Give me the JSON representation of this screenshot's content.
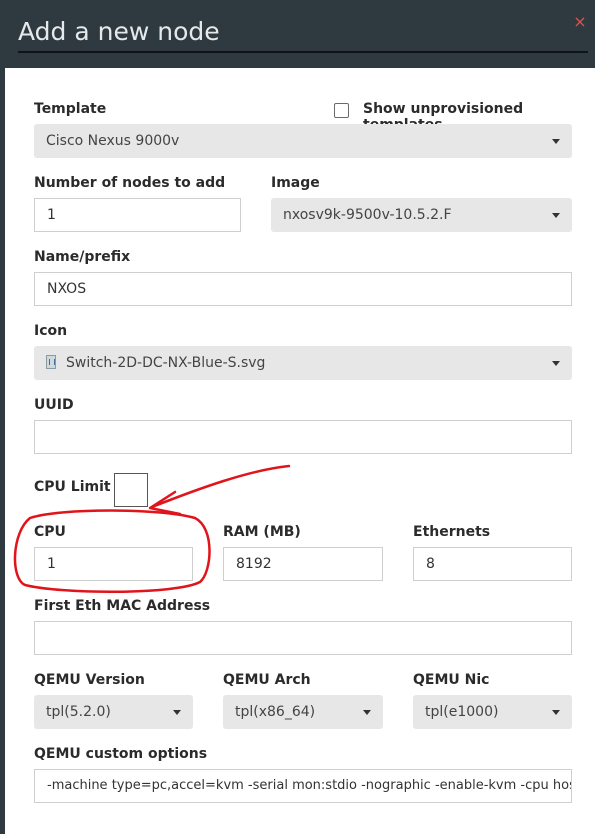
{
  "dialog": {
    "title": "Add a new node",
    "close_glyph": "×"
  },
  "template": {
    "label": "Template",
    "value": "Cisco Nexus 9000v",
    "show_unprovisioned_label": "Show unprovisioned templates",
    "show_unprovisioned_checked": false
  },
  "nodes_count": {
    "label": "Number of nodes to add",
    "value": "1"
  },
  "image": {
    "label": "Image",
    "value": "nxosv9k-9500v-10.5.2.F"
  },
  "name_prefix": {
    "label": "Name/prefix",
    "value": "NXOS"
  },
  "icon": {
    "label": "Icon",
    "value": "Switch-2D-DC-NX-Blue-S.svg",
    "icon_name": "switch-icon"
  },
  "uuid": {
    "label": "UUID",
    "value": ""
  },
  "cpu_limit": {
    "label": "CPU Limit",
    "checked": false
  },
  "cpu": {
    "label": "CPU",
    "value": "1"
  },
  "ram": {
    "label": "RAM (MB)",
    "value": "8192"
  },
  "ethernets": {
    "label": "Ethernets",
    "value": "8"
  },
  "mac": {
    "label": "First Eth MAC Address",
    "value": ""
  },
  "qemu_version": {
    "label": "QEMU Version",
    "value": "tpl(5.2.0)"
  },
  "qemu_arch": {
    "label": "QEMU Arch",
    "value": "tpl(x86_64)"
  },
  "qemu_nic": {
    "label": "QEMU Nic",
    "value": "tpl(e1000)"
  },
  "qemu_custom": {
    "label": "QEMU custom options",
    "value": "-machine type=pc,accel=kvm -serial mon:stdio -nographic -enable-kvm -cpu host"
  },
  "colors": {
    "header_bg": "#2f3a40",
    "annotation": "#e0141b",
    "close": "#d9534f"
  }
}
